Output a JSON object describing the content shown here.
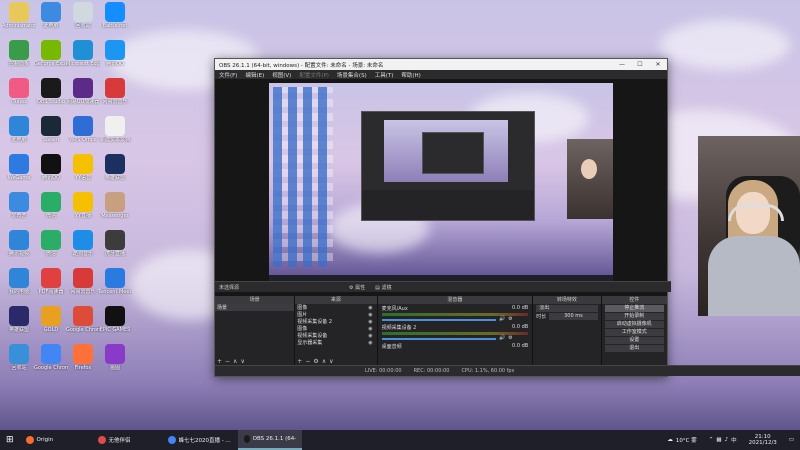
{
  "desktop": {
    "icons": [
      {
        "label": "Administrator",
        "color": "#e8c85a"
      },
      {
        "label": "此电脑",
        "color": "#3c8be0"
      },
      {
        "label": "回收站",
        "color": "#d0d8e0"
      },
      {
        "label": "Battle.net",
        "color": "#148eff"
      },
      {
        "label": "控制面板",
        "color": "#3a9c4a"
      },
      {
        "label": "GeForce Experience",
        "color": "#76b900"
      },
      {
        "label": "Microsoft Edge",
        "color": "#1f8fd6"
      },
      {
        "label": "腾讯QQ",
        "color": "#1d96f3"
      },
      {
        "label": "iTunes",
        "color": "#f05a84"
      },
      {
        "label": "OBS Studio",
        "color": "#1a1a1a"
      },
      {
        "label": "网易UU加速器",
        "color": "#5c2a88"
      },
      {
        "label": "网易云音乐",
        "color": "#d83a3a"
      },
      {
        "label": "此电脑",
        "color": "#2f86d8"
      },
      {
        "label": "Steam",
        "color": "#1b2838"
      },
      {
        "label": "WPS Office",
        "color": "#2e6cd6"
      },
      {
        "label": "新建文本文档",
        "color": "#f0f0f0"
      },
      {
        "label": "WeGame",
        "color": "#2d7be0"
      },
      {
        "label": "腾讯QQ",
        "color": "#111"
      },
      {
        "label": "YY语音",
        "color": "#f4c000"
      },
      {
        "label": "英雄联盟",
        "color": "#1a3060"
      },
      {
        "label": "爱奇艺",
        "color": "#3c8be0"
      },
      {
        "label": "微信",
        "color": "#2aae67"
      },
      {
        "label": "YY直播",
        "color": "#f4c000"
      },
      {
        "label": "Messenger",
        "color": "#c8a080"
      },
      {
        "label": "腾讯视频",
        "color": "#2f86d8"
      },
      {
        "label": "微信",
        "color": "#2aae67"
      },
      {
        "label": "酷狗音乐",
        "color": "#1d8ee8"
      },
      {
        "label": "虎牙直播",
        "color": "#3c3c3c"
      },
      {
        "label": "我的电脑",
        "color": "#2f86d8"
      },
      {
        "label": "PDF阅读器",
        "color": "#e04040"
      },
      {
        "label": "网易云音乐",
        "color": "#d83a3a"
      },
      {
        "label": "Tencent Meeting",
        "color": "#2a7be0"
      },
      {
        "label": "英雄联盟",
        "color": "#2a2a6a"
      },
      {
        "label": "GOLD",
        "color": "#e8a020"
      },
      {
        "label": "Google Chrome",
        "color": "#dd4b39"
      },
      {
        "label": "EPIC GAMES",
        "color": "#111"
      },
      {
        "label": "回收站",
        "color": "#3a90d8"
      },
      {
        "label": "Google Chrome",
        "color": "#4285f4"
      },
      {
        "label": "Firefox",
        "color": "#ff7139"
      },
      {
        "label": "画图",
        "color": "#8a3ac8"
      }
    ]
  },
  "obs": {
    "title": "OBS 26.1.1 (64-bit, windows) - 配置文件: 未命名 - 场景: 未命名",
    "win_min": "—",
    "win_max": "☐",
    "win_close": "✕",
    "menu": [
      "文件(F)",
      "编辑(E)",
      "视图(V)",
      "配置文件(P)",
      "场景集合(S)",
      "工具(T)",
      "帮助(H)"
    ],
    "bar_left": "未选择源",
    "bar_props": "属性",
    "bar_filters": "滤镜",
    "docks": {
      "scenes_title": "场景",
      "scenes": [
        "场景"
      ],
      "sources_title": "来源",
      "sources": [
        "图像",
        "图片",
        "视频采集设备 2",
        "图像",
        "视频采集设备",
        "显示器采集"
      ],
      "mixer_title": "混音器",
      "mixer": [
        {
          "name": "麦克风/Aux",
          "db": "0.0 dB"
        },
        {
          "name": "视频采集设备 2",
          "db": "0.0 dB"
        },
        {
          "name": "桌面音频",
          "db": "0.0 dB"
        }
      ],
      "transitions_title": "转场特效",
      "transition_type": "淡出",
      "duration_label": "时长",
      "duration_value": "300 ms",
      "controls_title": "控件",
      "controls": [
        "停止推流",
        "开始录制",
        "启动虚拟摄像机",
        "工作室模式",
        "设置",
        "退出"
      ]
    },
    "status": {
      "live": "LIVE: 00:00:00",
      "rec": "REC: 00:00:00",
      "cpu": "CPU: 1.1%, 60.00 fps"
    }
  },
  "taskbar": {
    "items": [
      {
        "label": "Origin",
        "color": "#f56c2d"
      },
      {
        "label": "无他伴侣",
        "color": "#e04a4a"
      },
      {
        "label": "蜂七七2020直播 - ...",
        "color": "#4285f4"
      },
      {
        "label": "OBS 26.1.1 (64-bit...",
        "color": "#1a1a1a"
      }
    ],
    "weather": "10°C 雾",
    "lang": "中",
    "time": "21:10",
    "date": "2021/12/3"
  }
}
